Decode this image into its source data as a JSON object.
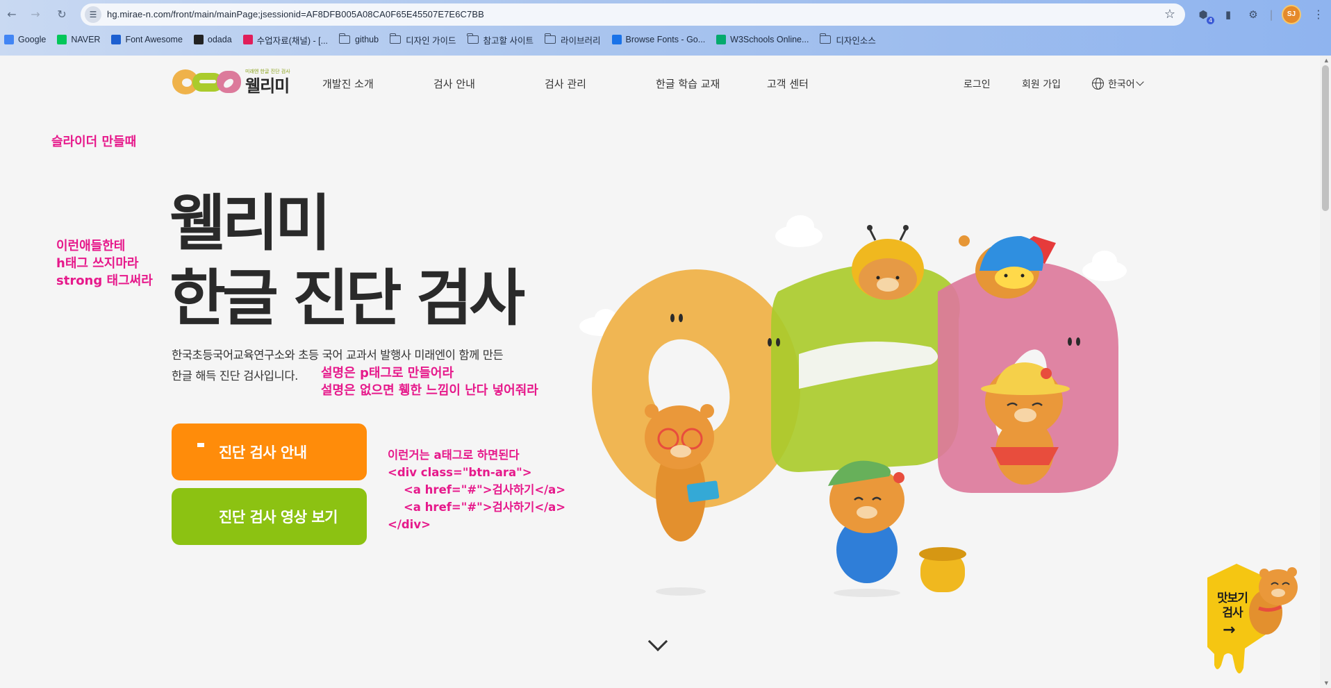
{
  "browser": {
    "url": "hg.mirae-n.com/front/main/mainPage;jsessionid=AF8DFB005A08CA0F65E45507E7E6C7BB",
    "profile_initials": "SJ",
    "ext_badge": "4",
    "bookmarks": [
      {
        "label": "Google",
        "icon": "google-icon",
        "kind": "site",
        "color": "#4285f4"
      },
      {
        "label": "NAVER",
        "icon": "naver-icon",
        "kind": "site",
        "color": "#03c75a"
      },
      {
        "label": "Font Awesome",
        "icon": "font-awesome-icon",
        "kind": "site",
        "color": "#1c5fd1"
      },
      {
        "label": "odada",
        "icon": "odada-icon",
        "kind": "site",
        "color": "#222222"
      },
      {
        "label": "수업자료(채널) - [...",
        "icon": "slack-icon",
        "kind": "site",
        "color": "#e01e5a"
      },
      {
        "label": "github",
        "icon": "folder-icon",
        "kind": "folder"
      },
      {
        "label": "디자인 가이드",
        "icon": "folder-icon",
        "kind": "folder"
      },
      {
        "label": "참고할 사이트",
        "icon": "folder-icon",
        "kind": "folder"
      },
      {
        "label": "라이브러리",
        "icon": "folder-icon",
        "kind": "folder"
      },
      {
        "label": "Browse Fonts - Go...",
        "icon": "google-fonts-icon",
        "kind": "site",
        "color": "#1a73e8"
      },
      {
        "label": "W3Schools Online...",
        "icon": "w3schools-icon",
        "kind": "site",
        "color": "#04aa6d"
      },
      {
        "label": "디자인소스",
        "icon": "folder-icon",
        "kind": "folder"
      }
    ]
  },
  "site": {
    "logo_tagline": "미래엔 한글 진단 검사",
    "logo_text": "웰리미",
    "nav": [
      "개발진 소개",
      "검사 안내",
      "검사 관리",
      "한글 학습 교재",
      "고객 센터"
    ],
    "login": "로그인",
    "signup": "회원 가입",
    "language": "한국어"
  },
  "hero": {
    "title_line1": "웰리미",
    "title_line2": "한글 진단 검사",
    "desc_line1": "한국초등국어교육연구소와 초등 국어 교과서 발행사 미래엔이 함께 만든",
    "desc_line2": "한글 해득 진단 검사입니다.",
    "cta_primary": "진단 검사 안내",
    "cta_secondary": "진단 검사 영상 보기"
  },
  "annotations": {
    "slider": "슬라이더 만들때",
    "heading": "이런애들한테\nh태그 쓰지마라\nstrong 태그써라",
    "desc": "설명은 p태그로 만들어라\n설명은 없으면 휑한 느낌이 난다 넣어줘라",
    "links": "이런거는 a태그로 하면된다\n<div class=\"btn-ara\">\n    <a href=\"#\">검사하기</a>\n    <a href=\"#\">검사하기</a>\n</div>"
  },
  "quick_test": {
    "label": "맛보기\n검사",
    "arrow": "→"
  },
  "colors": {
    "orange": "#ff8c0a",
    "green": "#8cc212",
    "annotation": "#e6198b",
    "o_letter": "#efb24a",
    "green_letter": "#aacb2c",
    "pink_letter": "#dc7a9b"
  }
}
